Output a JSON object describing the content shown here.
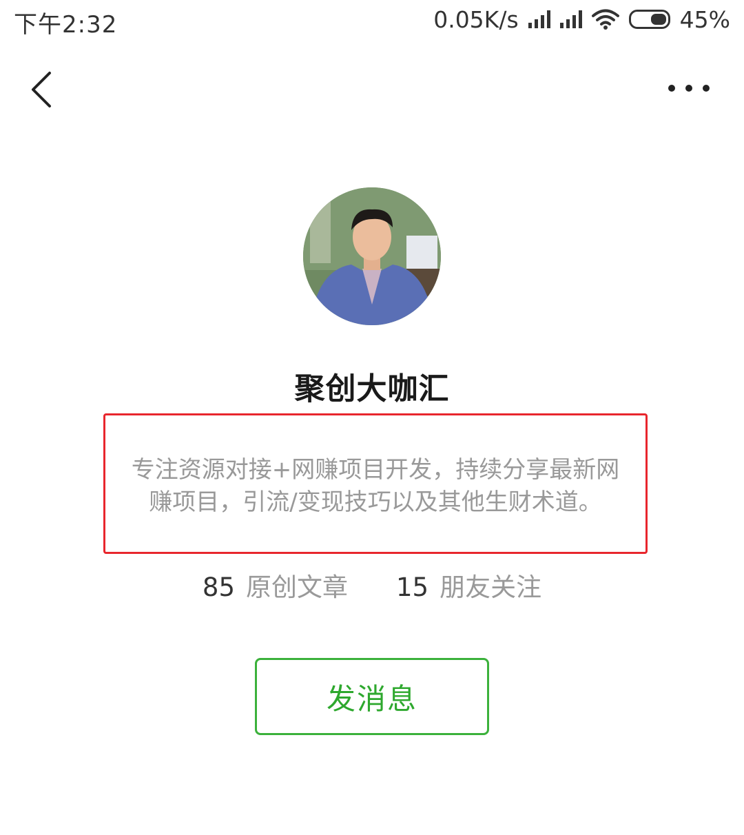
{
  "status_bar": {
    "time": "下午2:32",
    "network_speed": "0.05K/s",
    "battery_percent": "45%",
    "battery_level": 0.45
  },
  "nav": {
    "back_icon": "chevron-left-icon",
    "more_icon": "more-dots-icon"
  },
  "profile": {
    "avatar": "profile-avatar-photo",
    "name": "聚创大咖汇",
    "description": "专注资源对接+网赚项目开发，持续分享最新网赚项目，引流/变现技巧以及其他生财术道。"
  },
  "stats": {
    "articles_count": "85",
    "articles_label": "原创文章",
    "friends_count": "15",
    "friends_label": "朋友关注"
  },
  "actions": {
    "send_message_label": "发消息"
  },
  "colors": {
    "highlight_border": "#e8262d",
    "accent_green": "#2ea82e"
  }
}
